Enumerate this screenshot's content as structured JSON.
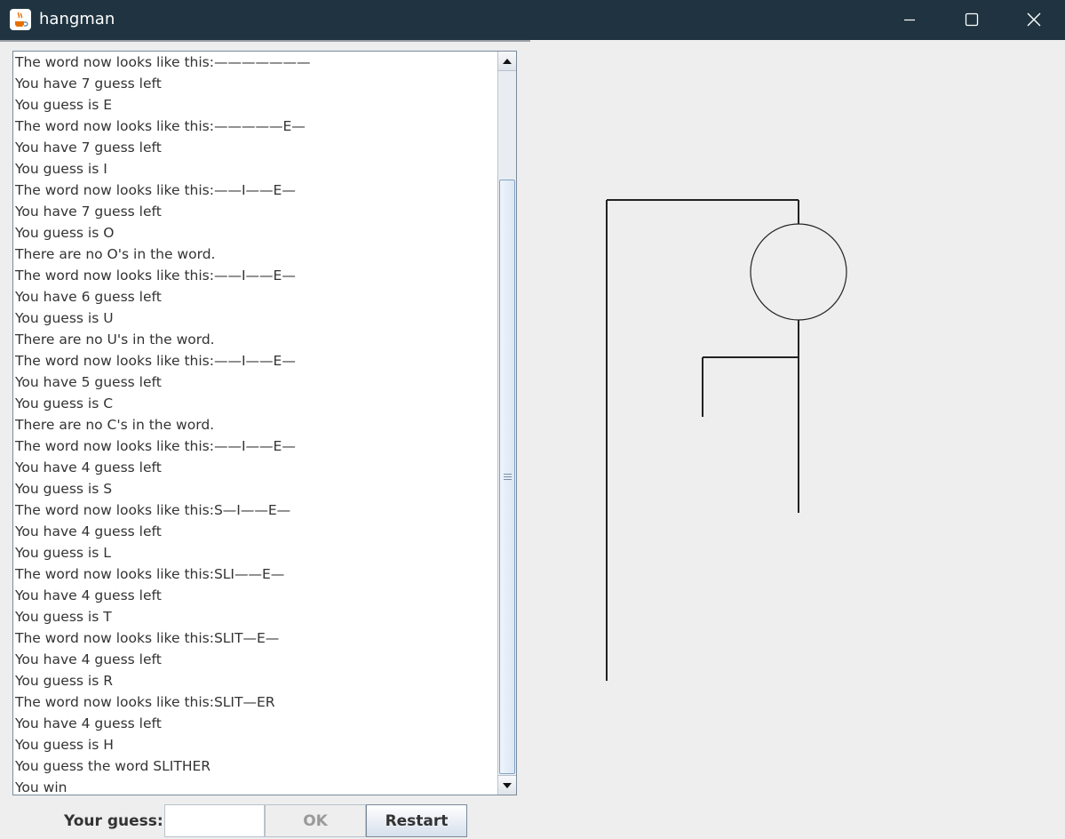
{
  "window": {
    "title": "hangman",
    "app_icon": "java-coffee-cup-icon",
    "controls": [
      "minimize-icon",
      "maximize-icon",
      "close-icon"
    ]
  },
  "log": {
    "lines": [
      "The word now looks like this:———————",
      "You have 7 guess left",
      "You guess is E",
      "The word now looks like this:—————E—",
      "You have 7 guess left",
      "You guess is I",
      "The word now looks like this:——I——E—",
      "You have 7 guess left",
      "You guess is O",
      "There are no O's in the word.",
      "The word now looks like this:——I——E—",
      "You have 6 guess left",
      "You guess is U",
      "There are no U's in the word.",
      "The word now looks like this:——I——E—",
      "You have 5 guess left",
      "You guess is C",
      "There are no C's in the word.",
      "The word now looks like this:——I——E—",
      "You have 4 guess left",
      "You guess is S",
      "The word now looks like this:S—I——E—",
      "You have 4 guess left",
      "You guess is L",
      "The word now looks like this:SLI——E—",
      "You have 4 guess left",
      "You guess is T",
      "The word now looks like this:SLIT—E—",
      "You have 4 guess left",
      "You guess is R",
      "The word now looks like this:SLIT—ER",
      "You have 4 guess left",
      "You guess is H",
      "You guess the word SLITHER",
      "You win"
    ]
  },
  "controls": {
    "guess_label": "Your guess:",
    "guess_value": "",
    "ok_label": "OK",
    "restart_label": "Restart"
  },
  "colors": {
    "titlebar": "#1f3440",
    "panel_bg": "#eeeeee",
    "drawing_stroke": "#222222",
    "disabled_text": "#9a9a9a"
  }
}
